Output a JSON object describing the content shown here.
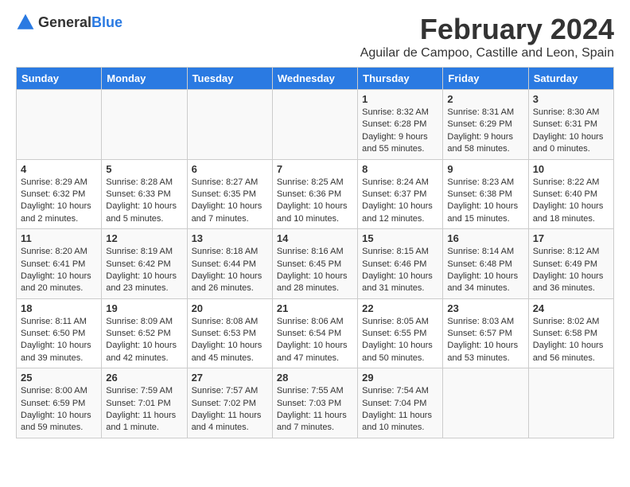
{
  "logo": {
    "text_general": "General",
    "text_blue": "Blue"
  },
  "title": "February 2024",
  "subtitle": "Aguilar de Campoo, Castille and Leon, Spain",
  "days_of_week": [
    "Sunday",
    "Monday",
    "Tuesday",
    "Wednesday",
    "Thursday",
    "Friday",
    "Saturday"
  ],
  "weeks": [
    [
      {
        "day": "",
        "info": ""
      },
      {
        "day": "",
        "info": ""
      },
      {
        "day": "",
        "info": ""
      },
      {
        "day": "",
        "info": ""
      },
      {
        "day": "1",
        "info": "Sunrise: 8:32 AM\nSunset: 6:28 PM\nDaylight: 9 hours and 55 minutes."
      },
      {
        "day": "2",
        "info": "Sunrise: 8:31 AM\nSunset: 6:29 PM\nDaylight: 9 hours and 58 minutes."
      },
      {
        "day": "3",
        "info": "Sunrise: 8:30 AM\nSunset: 6:31 PM\nDaylight: 10 hours and 0 minutes."
      }
    ],
    [
      {
        "day": "4",
        "info": "Sunrise: 8:29 AM\nSunset: 6:32 PM\nDaylight: 10 hours and 2 minutes."
      },
      {
        "day": "5",
        "info": "Sunrise: 8:28 AM\nSunset: 6:33 PM\nDaylight: 10 hours and 5 minutes."
      },
      {
        "day": "6",
        "info": "Sunrise: 8:27 AM\nSunset: 6:35 PM\nDaylight: 10 hours and 7 minutes."
      },
      {
        "day": "7",
        "info": "Sunrise: 8:25 AM\nSunset: 6:36 PM\nDaylight: 10 hours and 10 minutes."
      },
      {
        "day": "8",
        "info": "Sunrise: 8:24 AM\nSunset: 6:37 PM\nDaylight: 10 hours and 12 minutes."
      },
      {
        "day": "9",
        "info": "Sunrise: 8:23 AM\nSunset: 6:38 PM\nDaylight: 10 hours and 15 minutes."
      },
      {
        "day": "10",
        "info": "Sunrise: 8:22 AM\nSunset: 6:40 PM\nDaylight: 10 hours and 18 minutes."
      }
    ],
    [
      {
        "day": "11",
        "info": "Sunrise: 8:20 AM\nSunset: 6:41 PM\nDaylight: 10 hours and 20 minutes."
      },
      {
        "day": "12",
        "info": "Sunrise: 8:19 AM\nSunset: 6:42 PM\nDaylight: 10 hours and 23 minutes."
      },
      {
        "day": "13",
        "info": "Sunrise: 8:18 AM\nSunset: 6:44 PM\nDaylight: 10 hours and 26 minutes."
      },
      {
        "day": "14",
        "info": "Sunrise: 8:16 AM\nSunset: 6:45 PM\nDaylight: 10 hours and 28 minutes."
      },
      {
        "day": "15",
        "info": "Sunrise: 8:15 AM\nSunset: 6:46 PM\nDaylight: 10 hours and 31 minutes."
      },
      {
        "day": "16",
        "info": "Sunrise: 8:14 AM\nSunset: 6:48 PM\nDaylight: 10 hours and 34 minutes."
      },
      {
        "day": "17",
        "info": "Sunrise: 8:12 AM\nSunset: 6:49 PM\nDaylight: 10 hours and 36 minutes."
      }
    ],
    [
      {
        "day": "18",
        "info": "Sunrise: 8:11 AM\nSunset: 6:50 PM\nDaylight: 10 hours and 39 minutes."
      },
      {
        "day": "19",
        "info": "Sunrise: 8:09 AM\nSunset: 6:52 PM\nDaylight: 10 hours and 42 minutes."
      },
      {
        "day": "20",
        "info": "Sunrise: 8:08 AM\nSunset: 6:53 PM\nDaylight: 10 hours and 45 minutes."
      },
      {
        "day": "21",
        "info": "Sunrise: 8:06 AM\nSunset: 6:54 PM\nDaylight: 10 hours and 47 minutes."
      },
      {
        "day": "22",
        "info": "Sunrise: 8:05 AM\nSunset: 6:55 PM\nDaylight: 10 hours and 50 minutes."
      },
      {
        "day": "23",
        "info": "Sunrise: 8:03 AM\nSunset: 6:57 PM\nDaylight: 10 hours and 53 minutes."
      },
      {
        "day": "24",
        "info": "Sunrise: 8:02 AM\nSunset: 6:58 PM\nDaylight: 10 hours and 56 minutes."
      }
    ],
    [
      {
        "day": "25",
        "info": "Sunrise: 8:00 AM\nSunset: 6:59 PM\nDaylight: 10 hours and 59 minutes."
      },
      {
        "day": "26",
        "info": "Sunrise: 7:59 AM\nSunset: 7:01 PM\nDaylight: 11 hours and 1 minute."
      },
      {
        "day": "27",
        "info": "Sunrise: 7:57 AM\nSunset: 7:02 PM\nDaylight: 11 hours and 4 minutes."
      },
      {
        "day": "28",
        "info": "Sunrise: 7:55 AM\nSunset: 7:03 PM\nDaylight: 11 hours and 7 minutes."
      },
      {
        "day": "29",
        "info": "Sunrise: 7:54 AM\nSunset: 7:04 PM\nDaylight: 11 hours and 10 minutes."
      },
      {
        "day": "",
        "info": ""
      },
      {
        "day": "",
        "info": ""
      }
    ]
  ]
}
